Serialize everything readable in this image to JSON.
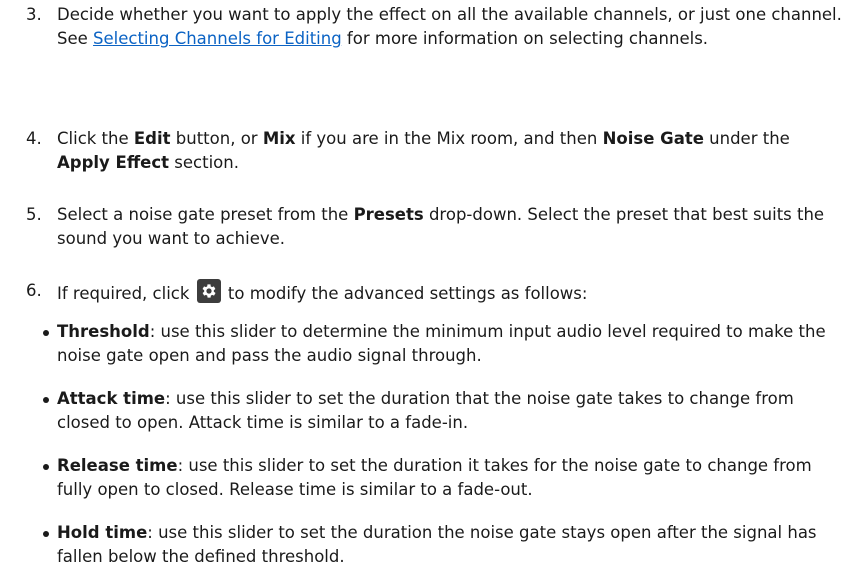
{
  "steps": [
    {
      "number": "3.",
      "text_before": "Decide whether you want to apply the effect on all the available channels, or just one channel. See ",
      "link": "Selecting Channels for Editing",
      "text_after": " for more information on selecting channels."
    },
    {
      "number": "4.",
      "t1": "Click the ",
      "b1": "Edit",
      "t2": " button, or ",
      "b2": "Mix",
      "t3": " if you are in the Mix room, and then ",
      "b3": "Noise Gate",
      "t4": " under the ",
      "b4": "Apply Effect",
      "t5": " section."
    },
    {
      "number": "5.",
      "t1": "Select a noise gate preset from the ",
      "b1": "Presets",
      "t2": " drop-down. Select the preset that best suits the sound you want to achieve."
    },
    {
      "number": "6.",
      "t1": "If required, click ",
      "icon": "gear-settings-icon",
      "t2": " to modify the advanced settings as follows:"
    }
  ],
  "bullets": [
    {
      "term": "Threshold",
      "text": ": use this slider to determine the minimum input audio level required to make the noise gate open and pass the audio signal through."
    },
    {
      "term": "Attack time",
      "text": ": use this slider to set the duration that the noise gate takes to change from closed to open. Attack time is similar to a fade-in."
    },
    {
      "term": "Release time",
      "text": ": use this slider to set the duration it takes for the noise gate to change from fully open to closed. Release time is similar to a fade-out."
    },
    {
      "term": "Hold time",
      "text": ": use this slider to set the duration the noise gate stays open after the signal has fallen below the defined threshold."
    }
  ],
  "colors": {
    "link": "#0b63c4",
    "text": "#1a1a1a",
    "icon_bg": "#3d3d3d"
  }
}
